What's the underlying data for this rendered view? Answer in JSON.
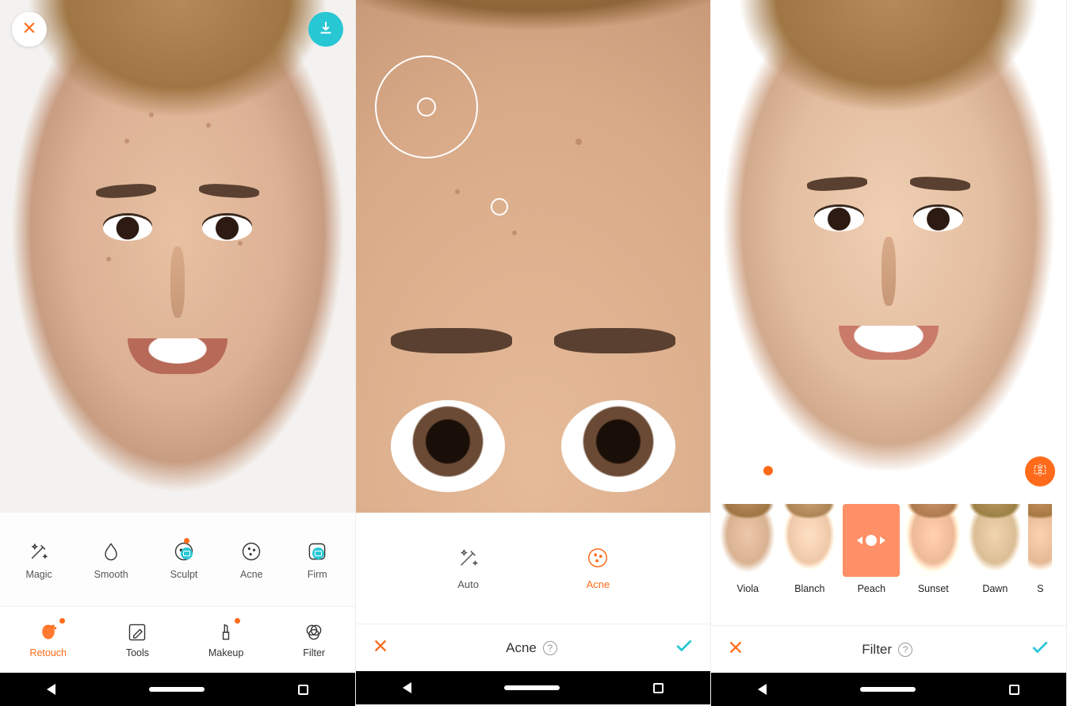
{
  "accent": "#ff6b1a",
  "teal": "#27c7d4",
  "screen1": {
    "photoHeight": 647,
    "tools": [
      {
        "id": "magic",
        "label": "Magic"
      },
      {
        "id": "smooth",
        "label": "Smooth"
      },
      {
        "id": "sculpt",
        "label": "Sculpt",
        "badgeDot": true,
        "badgeCam": true
      },
      {
        "id": "acne",
        "label": "Acne"
      },
      {
        "id": "firm",
        "label": "Firm",
        "badgeCam": true
      }
    ],
    "tabs": [
      {
        "id": "retouch",
        "label": "Retouch",
        "active": true,
        "badgeDot": true
      },
      {
        "id": "tools",
        "label": "Tools"
      },
      {
        "id": "makeup",
        "label": "Makeup",
        "badgeDot": true
      },
      {
        "id": "filter",
        "label": "Filter"
      }
    ]
  },
  "screen2": {
    "photoHeight": 647,
    "modes": [
      {
        "id": "auto",
        "label": "Auto",
        "active": false
      },
      {
        "id": "acne",
        "label": "Acne",
        "active": true
      }
    ],
    "title": "Acne"
  },
  "screen3": {
    "photoHeight": 622,
    "sliderValue": 0.12,
    "filters": [
      {
        "id": "viola",
        "label": "Viola"
      },
      {
        "id": "blanch",
        "label": "Blanch",
        "tint": "tint-blanch"
      },
      {
        "id": "peach",
        "label": "Peach",
        "selected": true
      },
      {
        "id": "sunset",
        "label": "Sunset",
        "tint": "tint-sunset"
      },
      {
        "id": "dawn",
        "label": "Dawn",
        "tint": "tint-dawn"
      },
      {
        "id": "s",
        "label": "S",
        "tint": "tint-s",
        "partial": true
      }
    ],
    "title": "Filter"
  }
}
